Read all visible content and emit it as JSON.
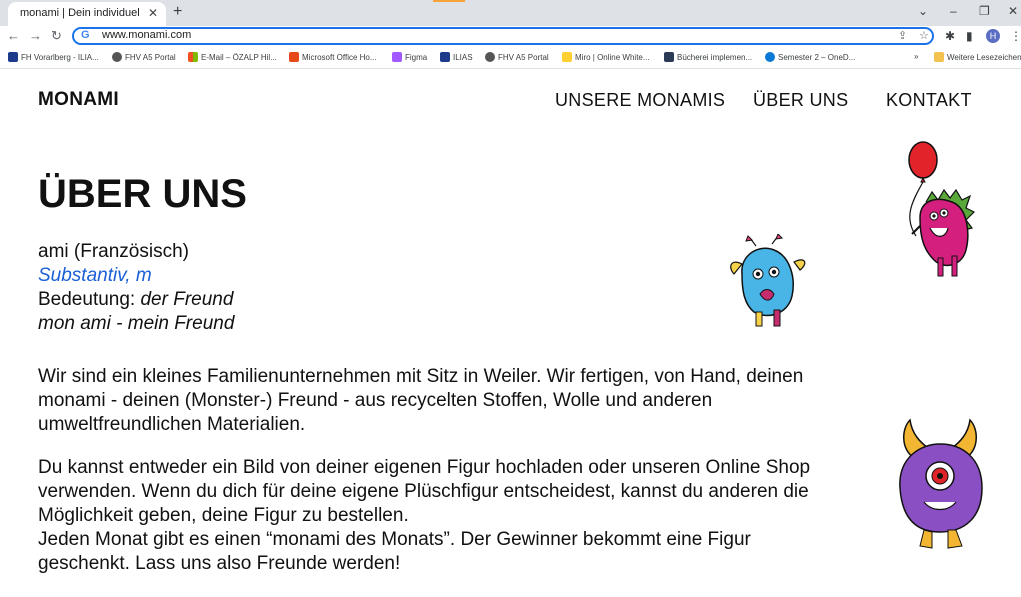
{
  "browser": {
    "tab_title": "monami | Dein individuel",
    "tab_close": "✕",
    "new_tab": "+",
    "url": "www.monami.com",
    "bookmarks": [
      {
        "label": "FH Vorarlberg - ILIA...",
        "color": "#1b3a8a"
      },
      {
        "label": "FHV A5 Portal",
        "color": "#555555"
      },
      {
        "label": "E-Mail – ÖZALP Hil...",
        "color": "#f25022"
      },
      {
        "label": "Microsoft Office Ho...",
        "color": "#e64a19"
      },
      {
        "label": "Figma",
        "color": "#a259ff"
      },
      {
        "label": "ILIAS",
        "color": "#1b3a8a"
      },
      {
        "label": "FHV A5 Portal",
        "color": "#555555"
      },
      {
        "label": "Miro | Online White...",
        "color": "#ffd02f"
      },
      {
        "label": "Bücherei implemen...",
        "color": "#2b3a55"
      },
      {
        "label": "Semester 2 – OneD...",
        "color": "#0a78d4"
      }
    ],
    "more_bookmarks": "»",
    "other_bookmarks": "Weitere Lesezeichen"
  },
  "header": {
    "brand": "MONAMI",
    "nav": [
      "UNSERE MONAMIS",
      "ÜBER UNS",
      "KONTAKT"
    ]
  },
  "main": {
    "title": "ÜBER UNS",
    "definition": {
      "word": "ami (Französisch)",
      "pos": "Substantiv, m",
      "meaning_label": "Bedeutung: ",
      "meaning": "der Freund",
      "example": "mon ami - mein Freund"
    },
    "paragraph1": "Wir sind ein kleines Familienunternehmen mit Sitz in Weiler. Wir fertigen, von Hand, deinen monami - deinen (Monster-) Freund - aus recycelten Stoffen, Wolle und anderen umweltfreundlichen Materialien.",
    "paragraph2": "Du kannst entweder ein Bild von deiner eigenen Figur hochladen oder unseren Online Shop verwenden. Wenn du dich für deine eigene Plüschfigur entscheidest, kannst du anderen die Möglichkeit geben, deine Figur zu bestellen.",
    "paragraph3": "Jeden Monat gibt es einen “monami des Monats”. Der Gewinner bekommt eine Figur geschenkt. Lass uns also Freunde werden!"
  },
  "colors": {
    "accent_blue": "#1a5fd6",
    "omnibox_border": "#1a73e8"
  },
  "icons": [
    "back-icon",
    "forward-icon",
    "reload-icon",
    "google-icon",
    "share-icon",
    "star-icon",
    "extensions-icon",
    "sidepanel-icon",
    "menu-icon",
    "minimize-icon",
    "maximize-icon",
    "close-icon"
  ]
}
